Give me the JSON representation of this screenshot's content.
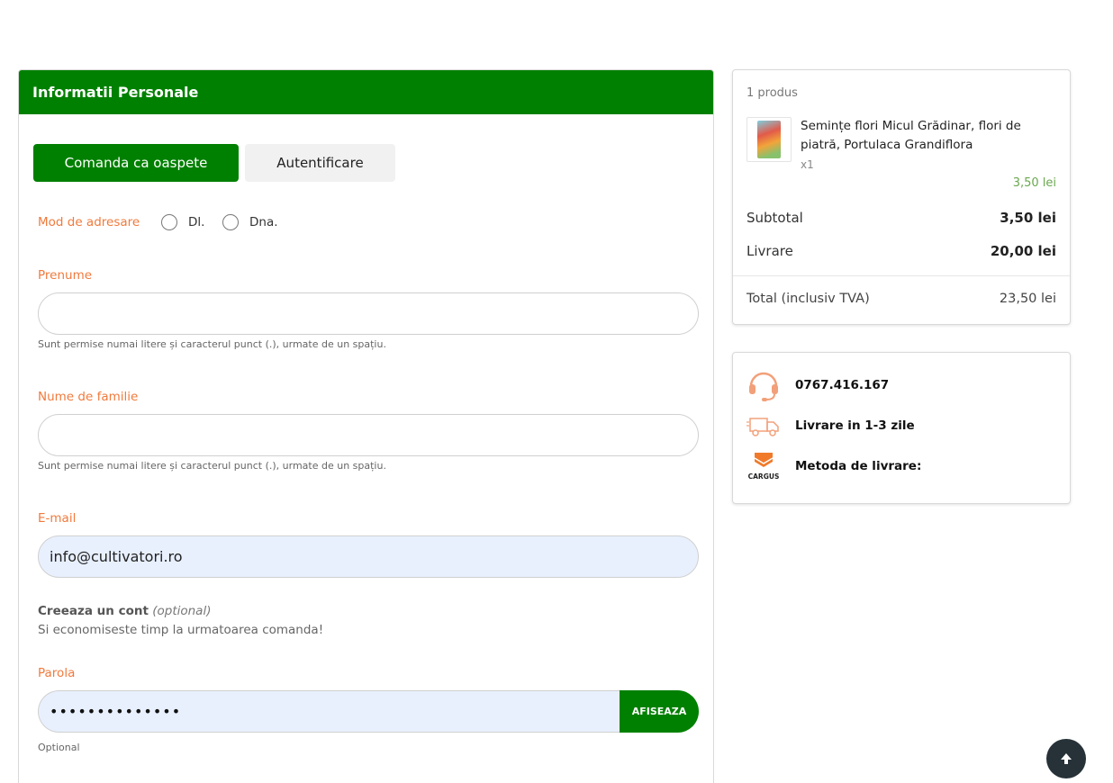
{
  "personal": {
    "header": "Informatii Personale",
    "tab_guest": "Comanda ca oaspete",
    "tab_login": "Autentificare",
    "salutation_label": "Mod de adresare",
    "salutation_options": [
      "Dl.",
      "Dna."
    ],
    "first_name_label": "Prenume",
    "first_name_value": "",
    "first_name_hint": "Sunt permise numai litere și caracterul punct (.), urmate de un spațiu.",
    "last_name_label": "Nume de familie",
    "last_name_value": "",
    "last_name_hint": "Sunt permise numai litere și caracterul punct (.), urmate de un spațiu.",
    "email_label": "E-mail",
    "email_value": "info@cultivatori.ro",
    "create_account_title": "Creeaza un cont",
    "create_account_optional": "(optional)",
    "create_account_sub": "Si economiseste timp la urmatoarea comanda!",
    "password_label": "Parola",
    "password_value": "••••••••••••••",
    "password_show": "AFISEAZA",
    "password_hint": "Optional"
  },
  "cart": {
    "count": "1 produs",
    "product_name": "Semințe flori Micul Grădinar, flori de piatră, Portulaca Grandiflora",
    "product_qty": "x1",
    "product_price": "3,50 lei",
    "subtotal_label": "Subtotal",
    "subtotal_value": "3,50 lei",
    "shipping_label": "Livrare",
    "shipping_value": "20,00 lei",
    "total_label": "Total (inclusiv TVA)",
    "total_value": "23,50 lei"
  },
  "info": {
    "phone": "0767.416.167",
    "delivery": "Livrare in 1-3 zile",
    "method": "Metoda de livrare:",
    "cargus_text": "CARGUS"
  },
  "colors": {
    "primary_green": "#008000",
    "label_orange": "#f07a3c",
    "price_green": "#6aa84f",
    "autofill_blue": "#e8f0fe"
  }
}
